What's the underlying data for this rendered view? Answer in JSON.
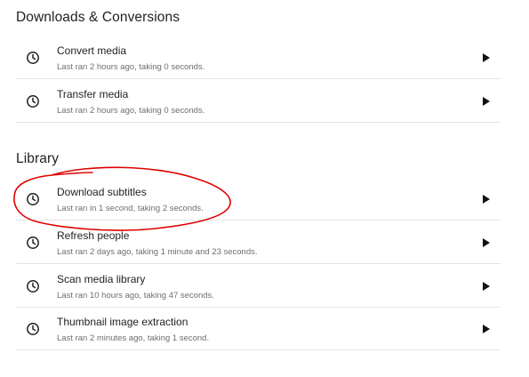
{
  "sections": [
    {
      "title": "Downloads & Conversions",
      "tasks": [
        {
          "name": "Convert media",
          "last_run": "Last ran 2 hours ago, taking 0 seconds."
        },
        {
          "name": "Transfer media",
          "last_run": "Last ran 2 hours ago, taking 0 seconds."
        }
      ]
    },
    {
      "title": "Library",
      "tasks": [
        {
          "name": "Download subtitles",
          "last_run": "Last ran in 1 second, taking 2 seconds."
        },
        {
          "name": "Refresh people",
          "last_run": "Last ran 2 days ago, taking 1 minute and 23 seconds."
        },
        {
          "name": "Scan media library",
          "last_run": "Last ran 10 hours ago, taking 47 seconds."
        },
        {
          "name": "Thumbnail image extraction",
          "last_run": "Last ran 2 minutes ago, taking 1 second."
        }
      ]
    }
  ],
  "icons": {
    "task": "clock-icon",
    "run": "play-icon"
  },
  "colors": {
    "annotation": "#e00000",
    "divider": "#e3e3e3",
    "secondary_text": "#6e6e6e"
  }
}
